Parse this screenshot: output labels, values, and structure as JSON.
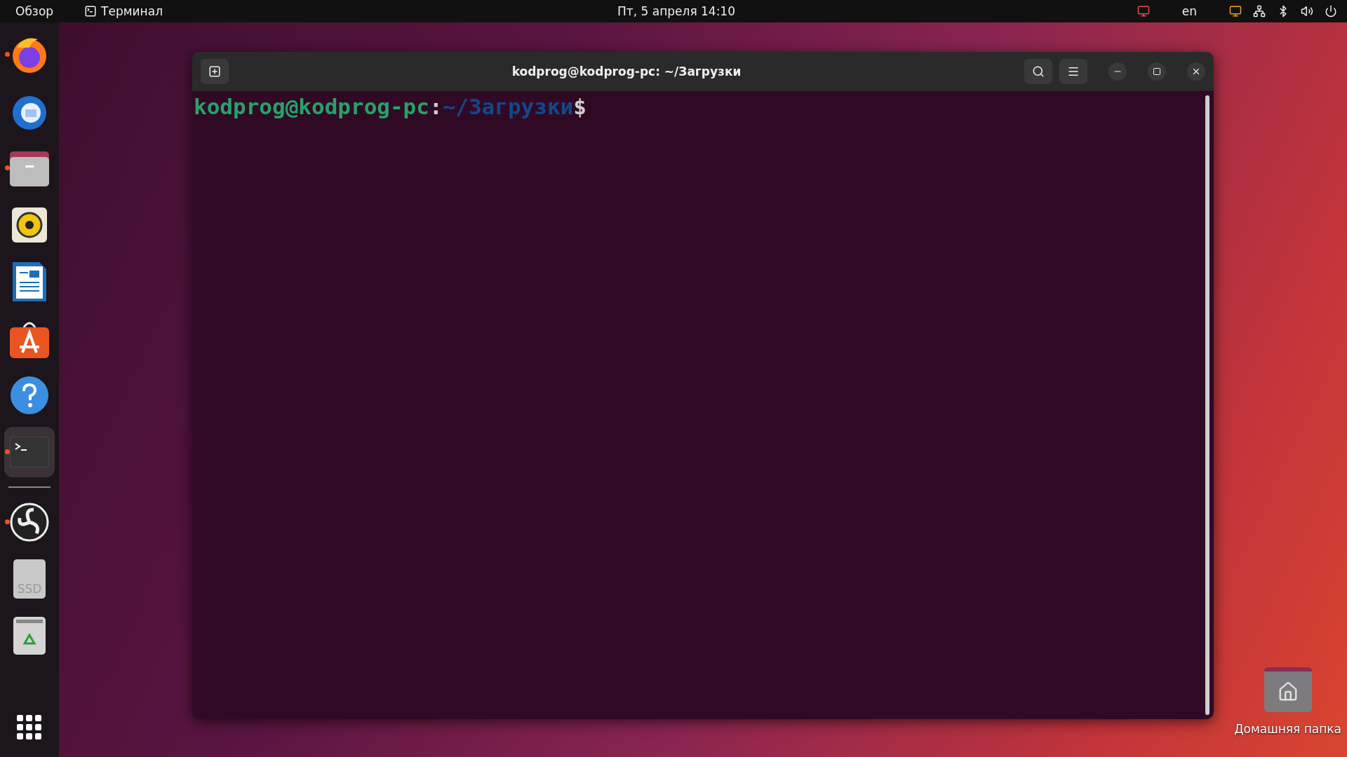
{
  "top_bar": {
    "activities": "Обзор",
    "app_menu": "Терминал",
    "clock": "Пт, 5 апреля  14:10",
    "keyboard_layout": "en"
  },
  "dock": {
    "items": [
      {
        "kind": "firefox",
        "running": true,
        "selected": false
      },
      {
        "kind": "thunderbird",
        "running": false,
        "selected": false
      },
      {
        "kind": "files",
        "running": true,
        "selected": false
      },
      {
        "kind": "rhythmbox",
        "running": false,
        "selected": false
      },
      {
        "kind": "writer",
        "running": false,
        "selected": false
      },
      {
        "kind": "software",
        "running": false,
        "selected": false
      },
      {
        "kind": "help",
        "running": false,
        "selected": false
      },
      {
        "kind": "terminal",
        "running": true,
        "selected": true
      },
      {
        "kind": "separator"
      },
      {
        "kind": "obs",
        "running": true,
        "selected": false
      },
      {
        "kind": "drive",
        "running": false,
        "selected": false,
        "label": "SSD"
      },
      {
        "kind": "trash",
        "running": false,
        "selected": false
      }
    ]
  },
  "terminal": {
    "title": "kodprog@kodprog-pc: ~/Загрузки",
    "prompt": {
      "user_host": "kodprog@kodprog-pc",
      "separator": ":",
      "path": "~/Загрузки",
      "symbol": "$"
    }
  },
  "desktop_icons": [
    {
      "label": "Домашняя папка"
    }
  ]
}
